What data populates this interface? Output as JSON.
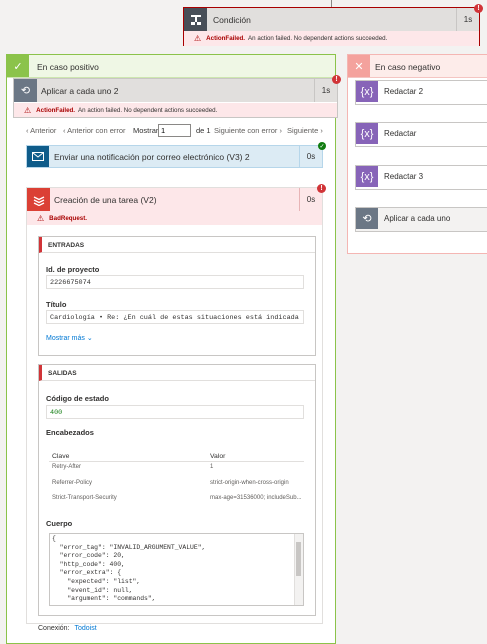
{
  "condition": {
    "title": "Condición",
    "duration": "1s",
    "error_badge": "!",
    "error_label": "ActionFailed.",
    "error_message": "An action failed. No dependent actions succeeded."
  },
  "positive_branch": {
    "title": "En caso positivo"
  },
  "negative_branch": {
    "title": "En caso negativo",
    "items": [
      {
        "label": "Redactar 2",
        "icon": "compose-icon"
      },
      {
        "label": "Redactar",
        "icon": "compose-icon"
      },
      {
        "label": "Redactar 3",
        "icon": "compose-icon"
      },
      {
        "label": "Aplicar a cada uno",
        "icon": "loop-icon"
      }
    ]
  },
  "apply_each": {
    "title": "Aplicar a cada uno 2",
    "duration": "1s",
    "error_label": "ActionFailed.",
    "error_message": "An action failed. No dependent actions succeeded."
  },
  "pager": {
    "previous": "Anterior",
    "previous_error": "Anterior con error",
    "show": "Mostrar",
    "current": "1",
    "of_total": "de 1",
    "next_error": "Siguiente con error",
    "next": "Siguiente"
  },
  "email_action": {
    "title": "Enviar una notificación por correo electrónico (V3) 2",
    "duration": "0s"
  },
  "task_action": {
    "title": "Creación de una tarea (V2)",
    "duration": "0s",
    "error_label": "BadRequest.",
    "inputs": {
      "header": "ENTRADAS",
      "project_label": "Id. de proyecto",
      "project_value": "2226675074",
      "title_label": "Título",
      "title_value": "Cardiología • Re: ¿En cuál de estas situaciones está indicada la reali",
      "show_more": "Mostrar más"
    },
    "outputs": {
      "header": "SALIDAS",
      "status_label": "Código de estado",
      "status_value": "400",
      "headers_label": "Encabezados",
      "col_key": "Clave",
      "col_value": "Valor",
      "rows": [
        {
          "key": "Retry-After",
          "value": "1"
        },
        {
          "key": "Referrer-Policy",
          "value": "strict-origin-when-cross-origin"
        },
        {
          "key": "Strict-Transport-Security",
          "value": "max-age=31536000; includeSub..."
        }
      ],
      "body_label": "Cuerpo",
      "body_lines": [
        "{",
        "  \"error_tag\": \"INVALID_ARGUMENT_VALUE\",",
        "  \"error_code\": 20,",
        "  \"http_code\": 400,",
        "  \"error_extra\": {",
        "    \"expected\": \"list\",",
        "    \"event_id\": null,",
        "    \"argument\": \"commands\","
      ]
    },
    "connection_label": "Conexión:",
    "connection_value": "Todoist"
  },
  "colors": {
    "error": "#d13438",
    "success": "#107c10",
    "compose": "#8764b8",
    "email": "#0f5c8a",
    "todoist": "#db4035",
    "control": "#6b7785"
  }
}
